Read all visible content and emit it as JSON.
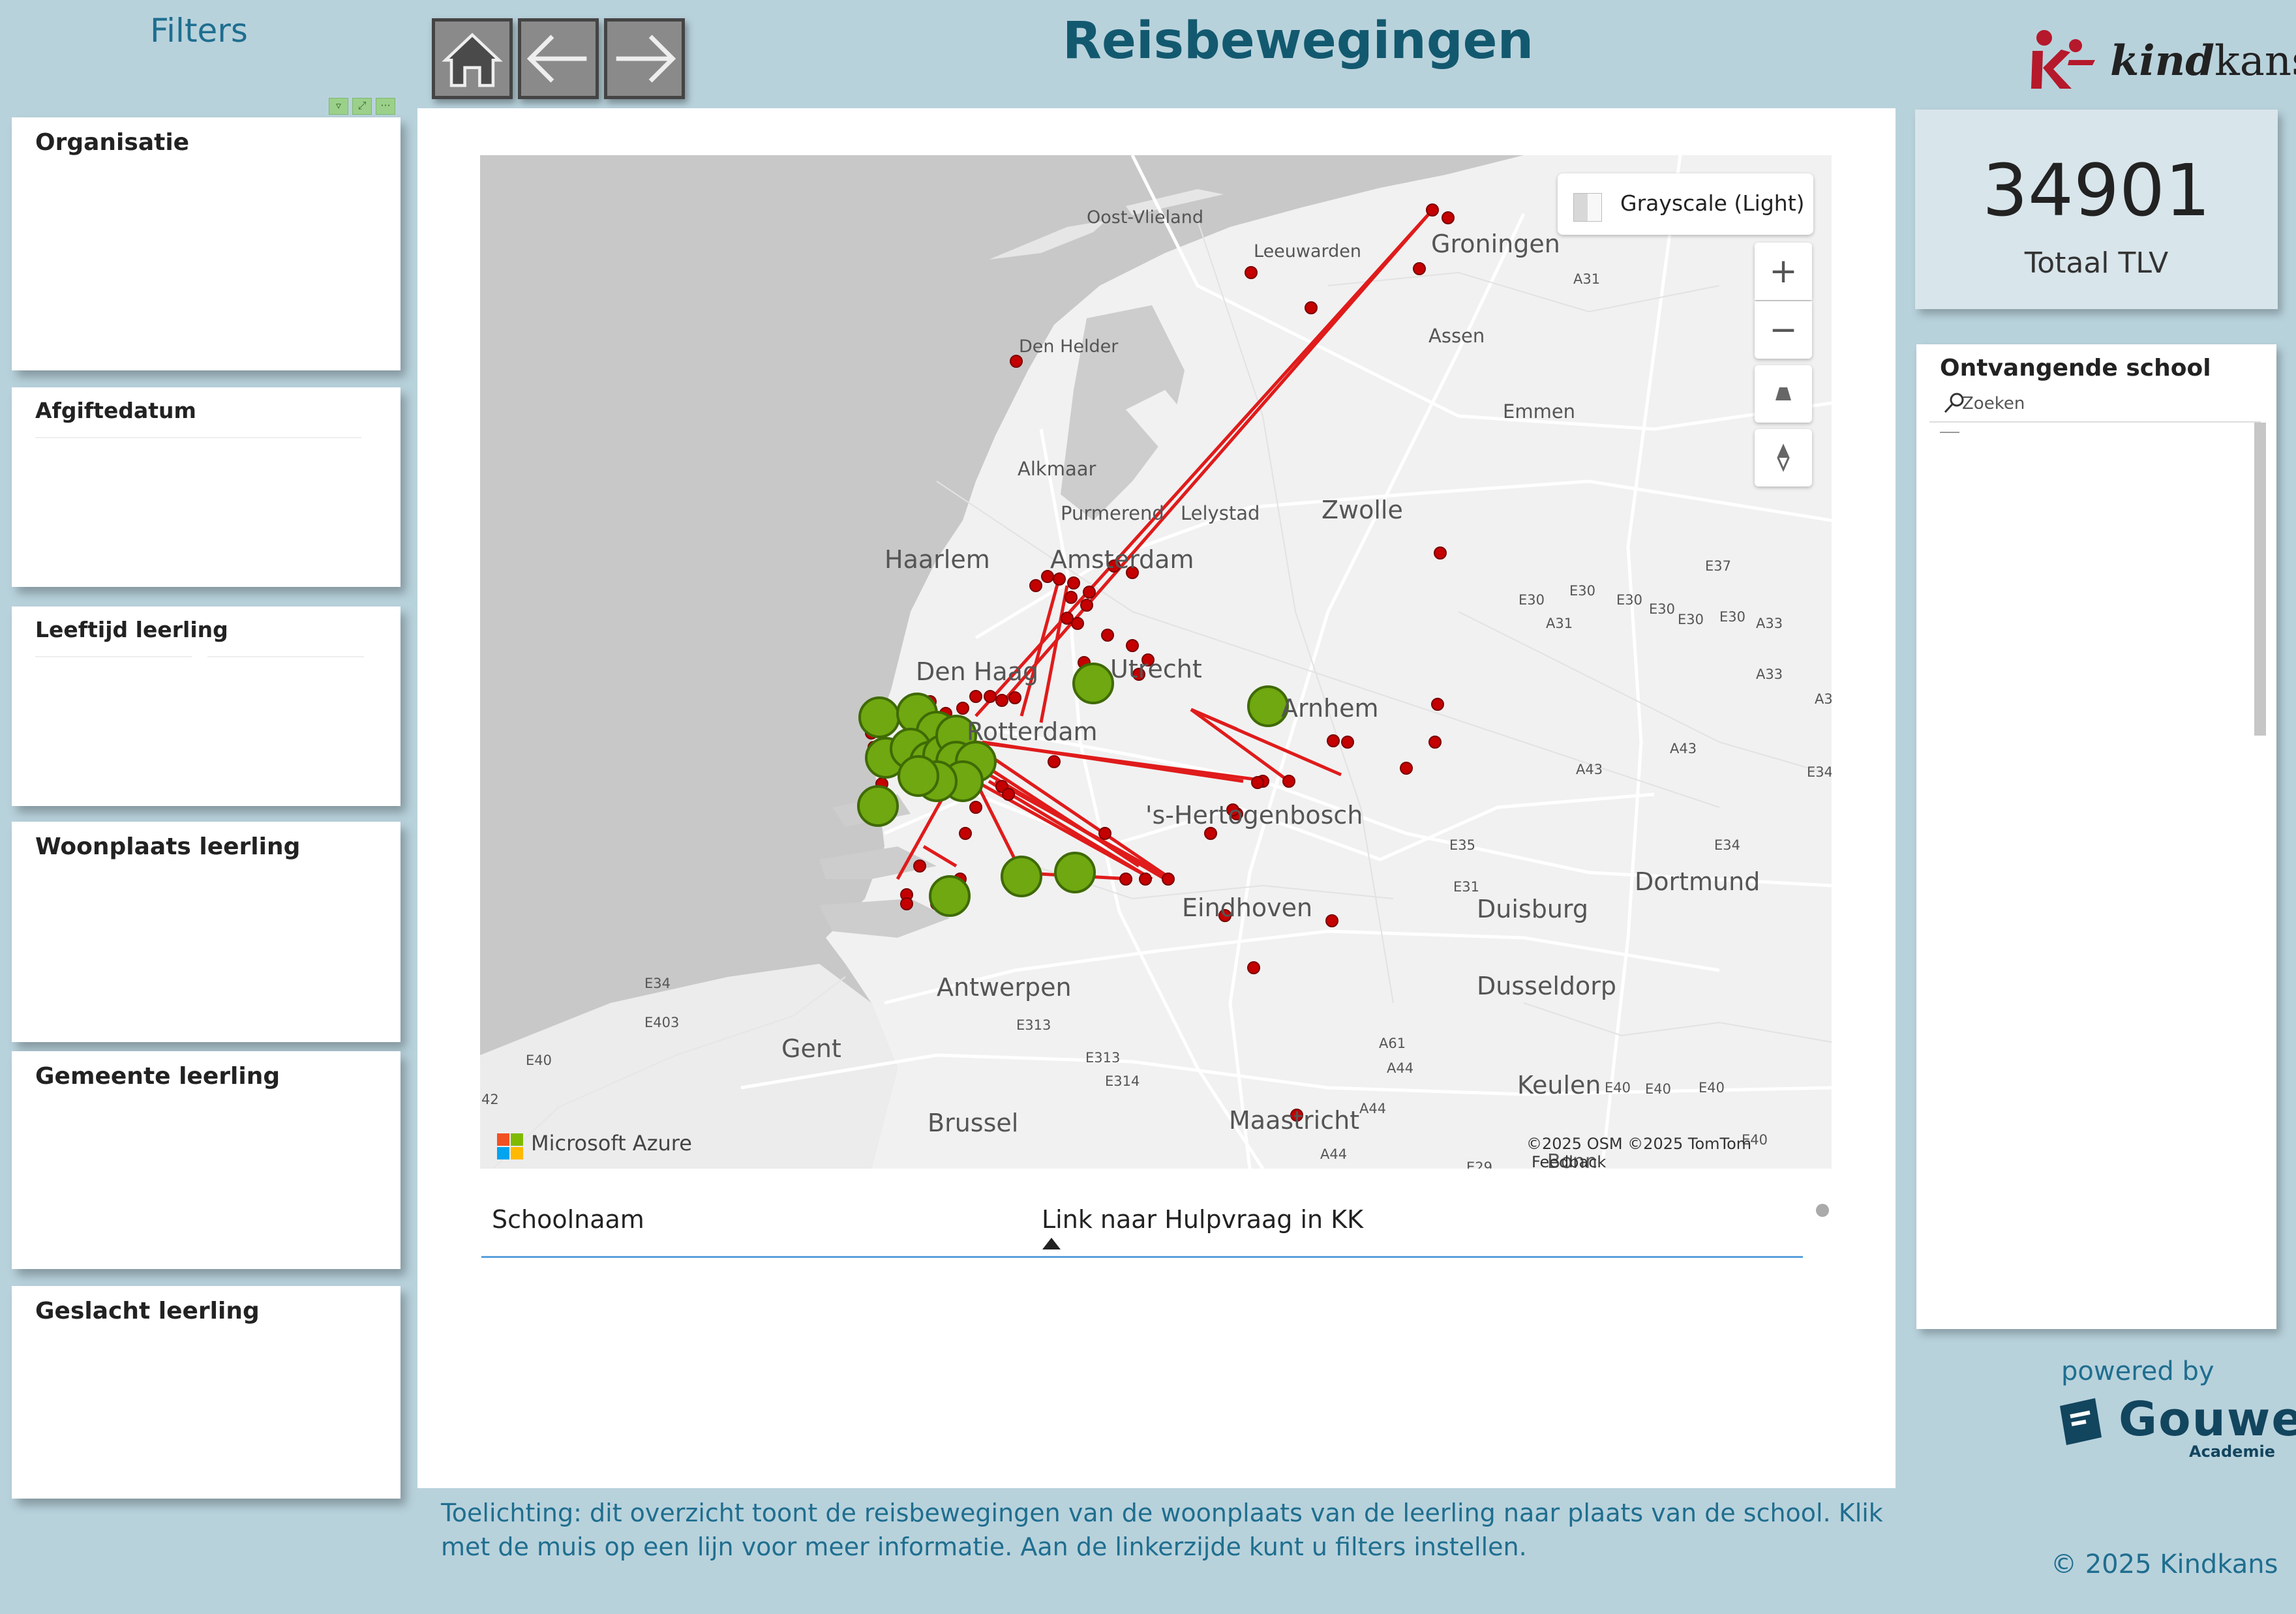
{
  "header": {
    "filters_title": "Filters",
    "page_title": "Reisbewegingen",
    "logo": {
      "word_bold": "kind",
      "word_regular": "kans"
    }
  },
  "nav": {
    "home_icon": "home-icon",
    "back_icon": "arrow-left-icon",
    "forward_icon": "arrow-right-icon"
  },
  "slicers": [
    {
      "title": "Organisatie"
    },
    {
      "title": "Afgiftedatum"
    },
    {
      "title": "Leeftijd leerling"
    },
    {
      "title": "Woonplaats leerling"
    },
    {
      "title": "Gemeente leerling"
    },
    {
      "title": "Geslacht leerling"
    }
  ],
  "map": {
    "style_label": "Grayscale (Light)",
    "zoom_in": "+",
    "zoom_out": "−",
    "branding": "Microsoft Azure",
    "attribution": "©2025 OSM  ©2025 TomTom",
    "feedback": "Feedback",
    "colors": {
      "route": "#e01b1b",
      "origin": "#c40000",
      "school": "#6fa810"
    },
    "places": [
      {
        "name": "Groningen",
        "size": "big"
      },
      {
        "name": "Leeuwarden",
        "size": "small"
      },
      {
        "name": "Oost-Vlieland",
        "size": "small"
      },
      {
        "name": "Den Helder",
        "size": "small"
      },
      {
        "name": "Assen",
        "size": "small"
      },
      {
        "name": "Emmen",
        "size": "small"
      },
      {
        "name": "Alkmaar",
        "size": "small"
      },
      {
        "name": "Purmerend",
        "size": "small"
      },
      {
        "name": "Lelystad",
        "size": "small"
      },
      {
        "name": "Zwolle",
        "size": "big"
      },
      {
        "name": "Haarlem",
        "size": "big"
      },
      {
        "name": "Amsterdam",
        "size": "big"
      },
      {
        "name": "Den Haag",
        "size": "big"
      },
      {
        "name": "Utrecht",
        "size": "big"
      },
      {
        "name": "Arnhem",
        "size": "big"
      },
      {
        "name": "Rotterdam",
        "size": "big"
      },
      {
        "name": "'s-Hertogenbosch",
        "size": "big"
      },
      {
        "name": "Eindhoven",
        "size": "big"
      },
      {
        "name": "Antwerpen",
        "size": "big"
      },
      {
        "name": "Gent",
        "size": "big"
      },
      {
        "name": "Brussel",
        "size": "big"
      },
      {
        "name": "Maastricht",
        "size": "big"
      },
      {
        "name": "Dortmund",
        "size": "big"
      },
      {
        "name": "Duisburg",
        "size": "big"
      },
      {
        "name": "Dusseldorp",
        "size": "big"
      },
      {
        "name": "Keulen",
        "size": "big"
      },
      {
        "name": "Bonn",
        "size": "big"
      }
    ],
    "roads": [
      "A31",
      "A31",
      "E37",
      "E30",
      "E30",
      "E30",
      "E30",
      "E30",
      "E30",
      "A33",
      "A33",
      "A3",
      "E34",
      "A43",
      "A43",
      "E35",
      "E31",
      "E34",
      "E34",
      "E403",
      "E313",
      "E313",
      "E314",
      "E40",
      "A61",
      "A44",
      "A44",
      "E40",
      "E40",
      "E40",
      "E40",
      "A44",
      "42",
      "E29"
    ]
  },
  "table": {
    "col_school": "Schoolnaam",
    "col_link": "Link naar Hulpvraag in KK"
  },
  "note": "Toelichting: dit overzicht toont de reisbewegingen van de woonplaats van de leerling naar plaats van de school. Klik met de muis op een lijn voor meer informatie. Aan de linkerzijde kunt u filters instellen.",
  "kpi": {
    "value": "34901",
    "label": "Totaal TLV"
  },
  "school_slicer": {
    "title": "Ontvangende school",
    "search_placeholder": "Zoeken"
  },
  "footer": {
    "powered_by": "powered by",
    "brand_name": "Gouwe",
    "brand_sub": "Academie",
    "copyright": "© 2025 Kindkans"
  }
}
